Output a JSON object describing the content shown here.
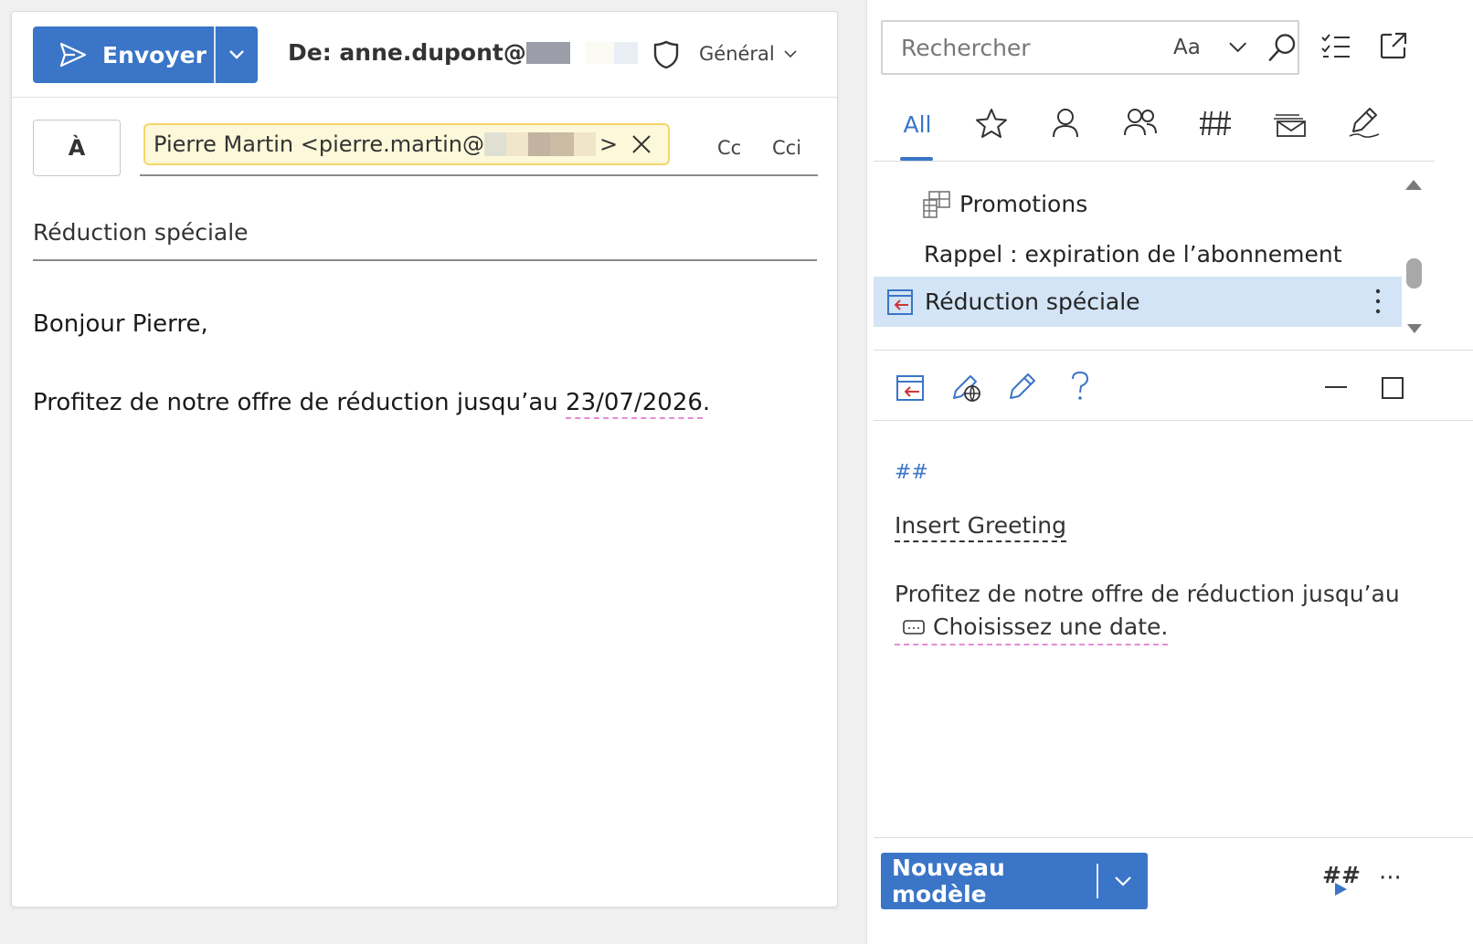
{
  "compose": {
    "send_label": "Envoyer",
    "from_prefix": "De: anne.dupont@",
    "sensitivity_label": "Général",
    "to_label": "À",
    "recipient": "Pierre Martin <pierre.martin@",
    "recipient_suffix": ">",
    "cc_label": "Cc",
    "bcc_label": "Cci",
    "subject": "Réduction spéciale",
    "body_greeting": "Bonjour Pierre,",
    "body_text": "Profitez de notre offre de réduction jusqu’au ",
    "body_date": "23/07/2026",
    "body_end": ".",
    "accent": "#3a75c8"
  },
  "pane": {
    "search_placeholder": "Rechercher",
    "match_case_label": "Aa",
    "filter_all_label": "All",
    "templates": [
      {
        "label": "Promotions",
        "icon": "folder-table-icon"
      },
      {
        "label": "Rappel : expiration de l’abonnement",
        "icon": ""
      },
      {
        "label": "Réduction spéciale",
        "icon": "insert-template-icon",
        "selected": true
      }
    ],
    "preview": {
      "hash_marker": "##",
      "greeting_field": "Insert Greeting",
      "text": "Profitez de notre offre de réduction jusqu’au",
      "date_placeholder": "Choisissez une date."
    },
    "new_template_label": "Nouveau modèle",
    "hash_run_label": "##",
    "more_label": "···"
  }
}
